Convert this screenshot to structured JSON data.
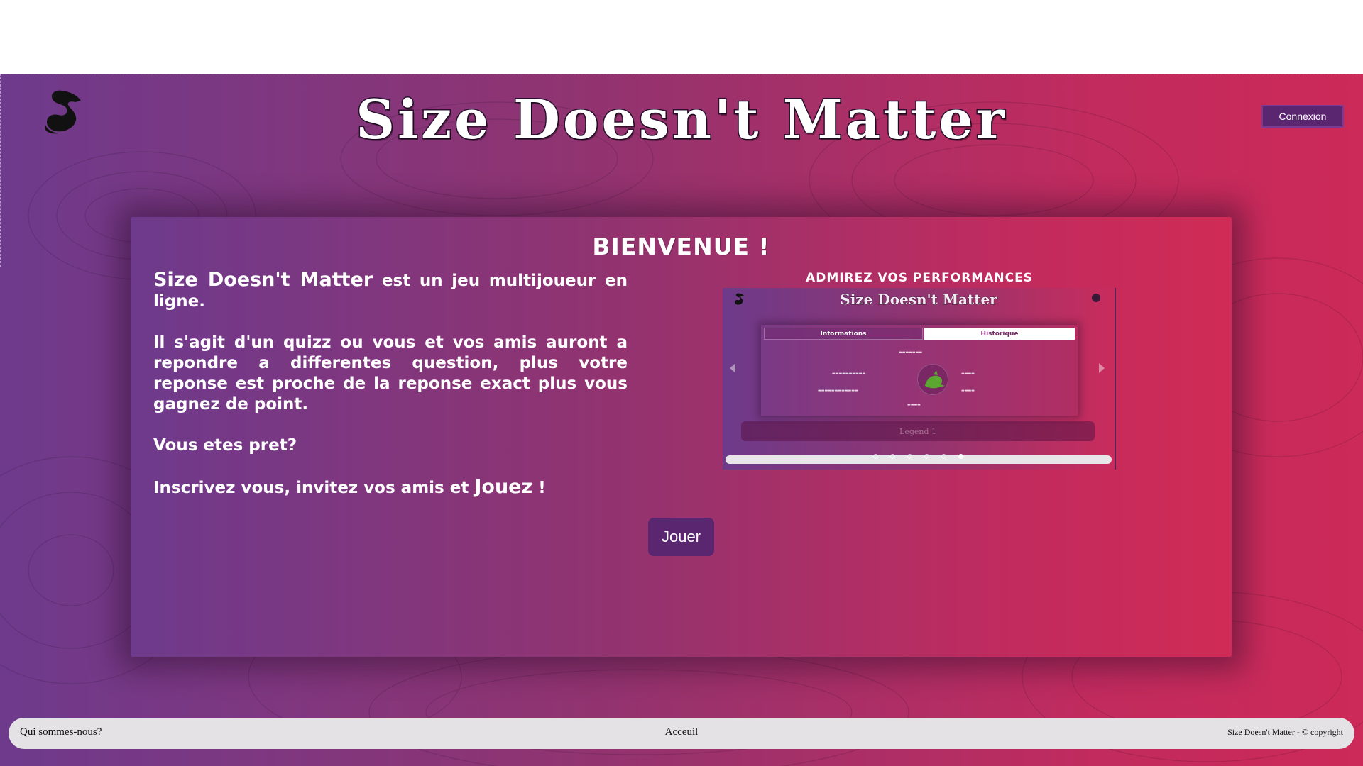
{
  "header": {
    "title": "Size Doesn't Matter",
    "login_label": "Connexion",
    "logo_icon": "snake-logo-icon"
  },
  "card": {
    "welcome": "BIENVENUE !",
    "intro": {
      "p1_brand": "Size Doesn't Matter",
      "p1_rest": " est un jeu multijoueur en ligne.",
      "p2": "Il s'agit d'un quizz ou vous et vos amis auront a repondre a differentes question, plus votre reponse est proche de la reponse exact plus vous gagnez de point.",
      "p3": "Vous etes pret?",
      "p4_start": "Inscrivez vous, invitez vos amis et ",
      "p4_play": "Jouez",
      "p4_end": " !"
    },
    "performance_title": "ADMIREZ VOS PERFORMANCES",
    "carousel": {
      "slide_title": "Size Doesn't Matter",
      "tab_info": "Informations",
      "tab_history": "Historique",
      "legend": "Legend 1",
      "dot_count": 6,
      "active_dot": 5
    },
    "play_label": "Jouer"
  },
  "footer": {
    "about": "Qui sommes-nous?",
    "home": "Acceuil",
    "copyright": "Size Doesn't Matter - © copyright"
  },
  "colors": {
    "gradient_start": "#6e3a8c",
    "gradient_end": "#cc2a58",
    "button_bg": "#5b2670",
    "footer_bg": "#e4e2e4"
  }
}
